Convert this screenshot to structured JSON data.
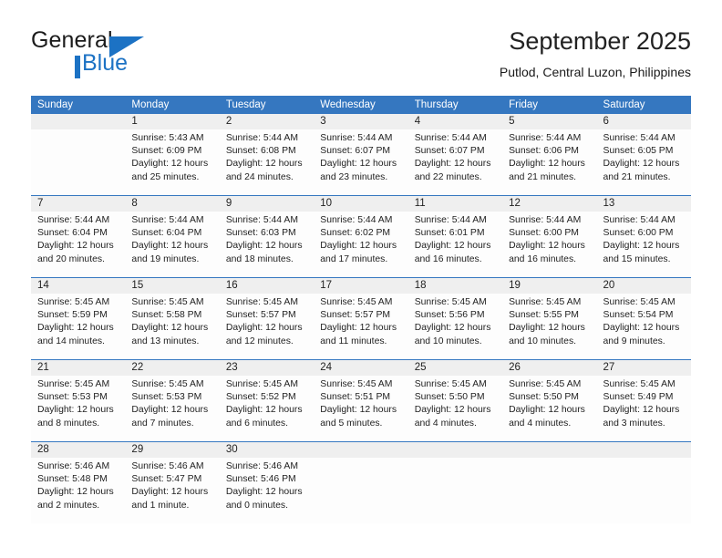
{
  "brand": {
    "name_part1": "General",
    "name_part2": "Blue",
    "logo_icon": "triangle-logo-icon",
    "accent_color": "#1c72c4"
  },
  "header": {
    "month_title": "September 2025",
    "location": "Putlod, Central Luzon, Philippines"
  },
  "calendar": {
    "header_color": "#3577c0",
    "daynum_band_color": "#efefef",
    "weekdays": [
      "Sunday",
      "Monday",
      "Tuesday",
      "Wednesday",
      "Thursday",
      "Friday",
      "Saturday"
    ],
    "weeks": [
      {
        "days": [
          {
            "num": "",
            "sunrise": "",
            "sunset": "",
            "daylight_1": "",
            "daylight_2": ""
          },
          {
            "num": "1",
            "sunrise": "Sunrise: 5:43 AM",
            "sunset": "Sunset: 6:09 PM",
            "daylight_1": "Daylight: 12 hours",
            "daylight_2": "and 25 minutes."
          },
          {
            "num": "2",
            "sunrise": "Sunrise: 5:44 AM",
            "sunset": "Sunset: 6:08 PM",
            "daylight_1": "Daylight: 12 hours",
            "daylight_2": "and 24 minutes."
          },
          {
            "num": "3",
            "sunrise": "Sunrise: 5:44 AM",
            "sunset": "Sunset: 6:07 PM",
            "daylight_1": "Daylight: 12 hours",
            "daylight_2": "and 23 minutes."
          },
          {
            "num": "4",
            "sunrise": "Sunrise: 5:44 AM",
            "sunset": "Sunset: 6:07 PM",
            "daylight_1": "Daylight: 12 hours",
            "daylight_2": "and 22 minutes."
          },
          {
            "num": "5",
            "sunrise": "Sunrise: 5:44 AM",
            "sunset": "Sunset: 6:06 PM",
            "daylight_1": "Daylight: 12 hours",
            "daylight_2": "and 21 minutes."
          },
          {
            "num": "6",
            "sunrise": "Sunrise: 5:44 AM",
            "sunset": "Sunset: 6:05 PM",
            "daylight_1": "Daylight: 12 hours",
            "daylight_2": "and 21 minutes."
          }
        ]
      },
      {
        "days": [
          {
            "num": "7",
            "sunrise": "Sunrise: 5:44 AM",
            "sunset": "Sunset: 6:04 PM",
            "daylight_1": "Daylight: 12 hours",
            "daylight_2": "and 20 minutes."
          },
          {
            "num": "8",
            "sunrise": "Sunrise: 5:44 AM",
            "sunset": "Sunset: 6:04 PM",
            "daylight_1": "Daylight: 12 hours",
            "daylight_2": "and 19 minutes."
          },
          {
            "num": "9",
            "sunrise": "Sunrise: 5:44 AM",
            "sunset": "Sunset: 6:03 PM",
            "daylight_1": "Daylight: 12 hours",
            "daylight_2": "and 18 minutes."
          },
          {
            "num": "10",
            "sunrise": "Sunrise: 5:44 AM",
            "sunset": "Sunset: 6:02 PM",
            "daylight_1": "Daylight: 12 hours",
            "daylight_2": "and 17 minutes."
          },
          {
            "num": "11",
            "sunrise": "Sunrise: 5:44 AM",
            "sunset": "Sunset: 6:01 PM",
            "daylight_1": "Daylight: 12 hours",
            "daylight_2": "and 16 minutes."
          },
          {
            "num": "12",
            "sunrise": "Sunrise: 5:44 AM",
            "sunset": "Sunset: 6:00 PM",
            "daylight_1": "Daylight: 12 hours",
            "daylight_2": "and 16 minutes."
          },
          {
            "num": "13",
            "sunrise": "Sunrise: 5:44 AM",
            "sunset": "Sunset: 6:00 PM",
            "daylight_1": "Daylight: 12 hours",
            "daylight_2": "and 15 minutes."
          }
        ]
      },
      {
        "days": [
          {
            "num": "14",
            "sunrise": "Sunrise: 5:45 AM",
            "sunset": "Sunset: 5:59 PM",
            "daylight_1": "Daylight: 12 hours",
            "daylight_2": "and 14 minutes."
          },
          {
            "num": "15",
            "sunrise": "Sunrise: 5:45 AM",
            "sunset": "Sunset: 5:58 PM",
            "daylight_1": "Daylight: 12 hours",
            "daylight_2": "and 13 minutes."
          },
          {
            "num": "16",
            "sunrise": "Sunrise: 5:45 AM",
            "sunset": "Sunset: 5:57 PM",
            "daylight_1": "Daylight: 12 hours",
            "daylight_2": "and 12 minutes."
          },
          {
            "num": "17",
            "sunrise": "Sunrise: 5:45 AM",
            "sunset": "Sunset: 5:57 PM",
            "daylight_1": "Daylight: 12 hours",
            "daylight_2": "and 11 minutes."
          },
          {
            "num": "18",
            "sunrise": "Sunrise: 5:45 AM",
            "sunset": "Sunset: 5:56 PM",
            "daylight_1": "Daylight: 12 hours",
            "daylight_2": "and 10 minutes."
          },
          {
            "num": "19",
            "sunrise": "Sunrise: 5:45 AM",
            "sunset": "Sunset: 5:55 PM",
            "daylight_1": "Daylight: 12 hours",
            "daylight_2": "and 10 minutes."
          },
          {
            "num": "20",
            "sunrise": "Sunrise: 5:45 AM",
            "sunset": "Sunset: 5:54 PM",
            "daylight_1": "Daylight: 12 hours",
            "daylight_2": "and 9 minutes."
          }
        ]
      },
      {
        "days": [
          {
            "num": "21",
            "sunrise": "Sunrise: 5:45 AM",
            "sunset": "Sunset: 5:53 PM",
            "daylight_1": "Daylight: 12 hours",
            "daylight_2": "and 8 minutes."
          },
          {
            "num": "22",
            "sunrise": "Sunrise: 5:45 AM",
            "sunset": "Sunset: 5:53 PM",
            "daylight_1": "Daylight: 12 hours",
            "daylight_2": "and 7 minutes."
          },
          {
            "num": "23",
            "sunrise": "Sunrise: 5:45 AM",
            "sunset": "Sunset: 5:52 PM",
            "daylight_1": "Daylight: 12 hours",
            "daylight_2": "and 6 minutes."
          },
          {
            "num": "24",
            "sunrise": "Sunrise: 5:45 AM",
            "sunset": "Sunset: 5:51 PM",
            "daylight_1": "Daylight: 12 hours",
            "daylight_2": "and 5 minutes."
          },
          {
            "num": "25",
            "sunrise": "Sunrise: 5:45 AM",
            "sunset": "Sunset: 5:50 PM",
            "daylight_1": "Daylight: 12 hours",
            "daylight_2": "and 4 minutes."
          },
          {
            "num": "26",
            "sunrise": "Sunrise: 5:45 AM",
            "sunset": "Sunset: 5:50 PM",
            "daylight_1": "Daylight: 12 hours",
            "daylight_2": "and 4 minutes."
          },
          {
            "num": "27",
            "sunrise": "Sunrise: 5:45 AM",
            "sunset": "Sunset: 5:49 PM",
            "daylight_1": "Daylight: 12 hours",
            "daylight_2": "and 3 minutes."
          }
        ]
      },
      {
        "days": [
          {
            "num": "28",
            "sunrise": "Sunrise: 5:46 AM",
            "sunset": "Sunset: 5:48 PM",
            "daylight_1": "Daylight: 12 hours",
            "daylight_2": "and 2 minutes."
          },
          {
            "num": "29",
            "sunrise": "Sunrise: 5:46 AM",
            "sunset": "Sunset: 5:47 PM",
            "daylight_1": "Daylight: 12 hours",
            "daylight_2": "and 1 minute."
          },
          {
            "num": "30",
            "sunrise": "Sunrise: 5:46 AM",
            "sunset": "Sunset: 5:46 PM",
            "daylight_1": "Daylight: 12 hours",
            "daylight_2": "and 0 minutes."
          },
          {
            "num": "",
            "sunrise": "",
            "sunset": "",
            "daylight_1": "",
            "daylight_2": ""
          },
          {
            "num": "",
            "sunrise": "",
            "sunset": "",
            "daylight_1": "",
            "daylight_2": ""
          },
          {
            "num": "",
            "sunrise": "",
            "sunset": "",
            "daylight_1": "",
            "daylight_2": ""
          },
          {
            "num": "",
            "sunrise": "",
            "sunset": "",
            "daylight_1": "",
            "daylight_2": ""
          }
        ]
      }
    ]
  }
}
